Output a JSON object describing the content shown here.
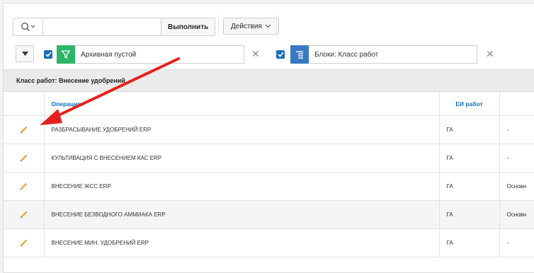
{
  "toolbar": {
    "search_value": "",
    "run_label": "Выполнить",
    "actions_label": "Действия"
  },
  "filters": [
    {
      "label": "Архивная пустой",
      "checked": true,
      "icon": "filter-icon",
      "color": "#2db567"
    },
    {
      "label": "Блоки: Класс работ",
      "checked": true,
      "icon": "control-break-icon",
      "color": "#3a78c2"
    }
  ],
  "group": {
    "title": "Класс работ: Внесение удобрений"
  },
  "table": {
    "columns": [
      "",
      "Операция",
      "ЕИ работ",
      ""
    ],
    "rows": [
      {
        "operation": "РАЗБРАСЫВАНИЕ УДОБРЕНИЙ ERP",
        "unit": "ГА",
        "extra": "-"
      },
      {
        "operation": "КУЛЬТИВАЦИЯ С ВНЕСЕНИЕМ КАС ERP",
        "unit": "ГА",
        "extra": "-"
      },
      {
        "operation": "ВНЕСЕНИЕ ЖСС ERP",
        "unit": "ГА",
        "extra": "Основн"
      },
      {
        "operation": "ВНЕСЕНИЕ БЕЗВОДНОГО АММИАКА ERP",
        "unit": "ГА",
        "extra": "Основн"
      },
      {
        "operation": "ВНЕСЕНИЕ МИН. УДОБРЕНИЙ ERP",
        "unit": "ГА",
        "extra": "-"
      }
    ]
  },
  "colors": {
    "accent": "#0a6fc7",
    "annotation_arrow": "#e8201c",
    "edit_pencil": "#f0a020"
  }
}
